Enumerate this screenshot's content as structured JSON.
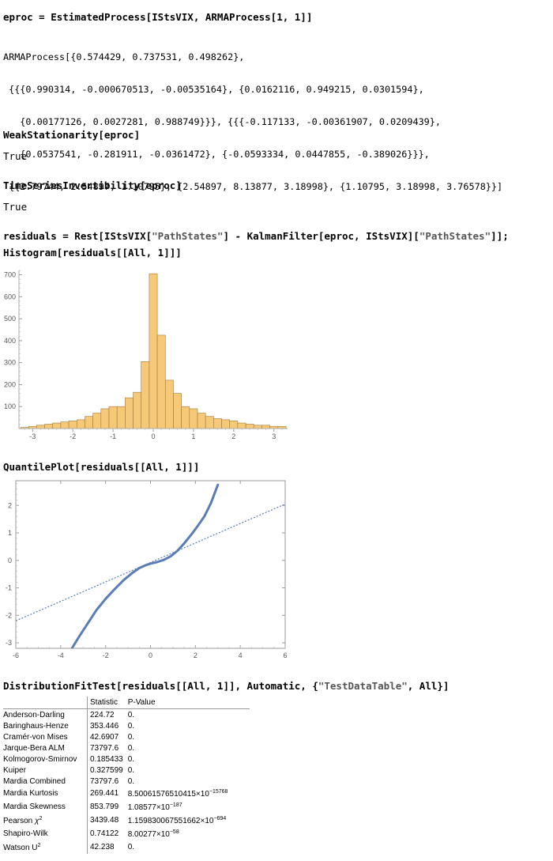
{
  "cells": {
    "eproc_in": {
      "lhs": "eproc",
      "mid": " = EstimatedProcess[IStsVIX, ARMAProcess[1, 1]]"
    },
    "arma_out": {
      "head": "ARMAProcess[{0.574429, 0.737531, 0.498262},",
      "l2": " {{{0.990314, -0.000670513, -0.00535164}, {0.0162116, 0.949215, 0.0301594},",
      "l3": "   {0.00177126, 0.0027281, 0.988749}}}, {{{-0.117133, -0.00361907, 0.0209439},",
      "l4": "   {0.0537541, -0.281911, -0.0361472}, {-0.0593334, 0.0447855, -0.389026}}},",
      "l5": " {{2.79744, 2.54897, 1.10795}, {2.54897, 8.13877, 3.18998}, {1.10795, 3.18998, 3.76578}}]"
    },
    "weak_in": "WeakStationarity[eproc]",
    "weak_out": "True",
    "inv_in": "TimeSeriesInvertibility[eproc]",
    "inv_out": "True",
    "resid_in_a": "residuals = Rest[IStsVIX[",
    "resid_str1": "\"PathStates\"",
    "resid_in_b": "] - KalmanFilter[eproc, IStsVIX][",
    "resid_str2": "\"PathStates\"",
    "resid_in_c": "]];",
    "hist_in": "Histogram[residuals[[All, 1]]]",
    "qq_in": "QuantilePlot[residuals[[All, 1]]]",
    "dft_in_a": "DistributionFitTest[residuals[[All, 1]], Automatic, {",
    "dft_str": "\"TestDataTable\"",
    "dft_in_b": ", All}]"
  },
  "histogram": {
    "type": "bar",
    "bin_edges_start": -3.3,
    "bin_width": 0.2,
    "values": [
      5,
      10,
      15,
      20,
      25,
      30,
      35,
      40,
      55,
      70,
      90,
      100,
      100,
      140,
      165,
      305,
      705,
      425,
      220,
      160,
      100,
      90,
      70,
      55,
      45,
      40,
      35,
      25,
      20,
      15,
      15,
      10,
      10
    ],
    "x_ticks": [
      "-3",
      "-2",
      "-1",
      "0",
      "1",
      "2",
      "3"
    ],
    "x_tick_values": [
      -3,
      -2,
      -1,
      0,
      1,
      2,
      3
    ],
    "y_ticks": [
      "100",
      "200",
      "300",
      "400",
      "500",
      "600",
      "700"
    ],
    "y_tick_values": [
      100,
      200,
      300,
      400,
      500,
      600,
      700
    ],
    "xlim": [
      -3.3,
      3.3
    ],
    "ylim": [
      0,
      720
    ],
    "bar_color": "#f6c978",
    "edge_color": "#a07a3a"
  },
  "quantile_plot": {
    "type": "scatter",
    "x_ticks": [
      "-6",
      "-4",
      "-2",
      "0",
      "2",
      "4",
      "6"
    ],
    "x_tick_values": [
      -6,
      -4,
      -2,
      0,
      2,
      4,
      6
    ],
    "y_ticks": [
      "2",
      "1",
      "0",
      "-1",
      "-2",
      "-3"
    ],
    "y_tick_values": [
      2,
      1,
      0,
      -1,
      -2,
      -3
    ],
    "xlim": [
      -6,
      6
    ],
    "ylim": [
      -3.2,
      2.9
    ],
    "reference_line": {
      "x": [
        -6,
        6
      ],
      "y": [
        -2.2,
        2.05
      ]
    },
    "points": [
      [
        -3.5,
        -3.2
      ],
      [
        -3.2,
        -2.8
      ],
      [
        -2.8,
        -2.3
      ],
      [
        -2.4,
        -1.8
      ],
      [
        -2.0,
        -1.4
      ],
      [
        -1.6,
        -1.05
      ],
      [
        -1.2,
        -0.72
      ],
      [
        -0.8,
        -0.45
      ],
      [
        -0.5,
        -0.28
      ],
      [
        -0.2,
        -0.17
      ],
      [
        0,
        -0.12
      ],
      [
        0.3,
        -0.06
      ],
      [
        0.6,
        0.02
      ],
      [
        0.9,
        0.15
      ],
      [
        1.2,
        0.35
      ],
      [
        1.5,
        0.62
      ],
      [
        1.8,
        0.92
      ],
      [
        2.1,
        1.25
      ],
      [
        2.4,
        1.6
      ],
      [
        2.7,
        2.1
      ],
      [
        3.0,
        2.75
      ]
    ],
    "point_color": "#5b7db5"
  },
  "fit_table": {
    "headers": [
      "Statistic",
      "P-Value"
    ],
    "rows": [
      {
        "name": "Anderson-Darling",
        "stat": "224.72",
        "p": "0."
      },
      {
        "name": "Baringhaus-Henze",
        "stat": "353.446",
        "p": "0."
      },
      {
        "name": "Cramér-von Mises",
        "stat": "42.6907",
        "p": "0."
      },
      {
        "name": "Jarque-Bera ALM",
        "stat": "73797.6",
        "p": "0."
      },
      {
        "name": "Kolmogorov-Smirnov",
        "stat": "0.185433",
        "p": "0."
      },
      {
        "name": "Kuiper",
        "stat": "0.327599",
        "p": "0."
      },
      {
        "name": "Mardia Combined",
        "stat": "73797.6",
        "p": "0."
      }
    ],
    "mardia_kurtosis": {
      "name": "Mardia Kurtosis",
      "stat": "269.441",
      "p_base": "8.50061576510415×10",
      "p_exp": "−15768"
    },
    "mardia_skewness": {
      "name": "Mardia Skewness",
      "stat": "853.799",
      "p_base": "1.08577×10",
      "p_exp": "−187"
    },
    "pearson": {
      "name_a": "Pearson ",
      "name_chi": "χ",
      "name_exp": "2",
      "stat": "3439.48",
      "p_base": "1.15983006755166​2×10",
      "p_exp": "−694"
    },
    "shapiro": {
      "name": "Shapiro-Wilk",
      "stat": "0.74122",
      "p_base": "8.00277×10",
      "p_exp": "−58"
    },
    "watson": {
      "name_a": "Watson U",
      "name_exp": "2",
      "stat": "42.238",
      "p": "0."
    }
  }
}
